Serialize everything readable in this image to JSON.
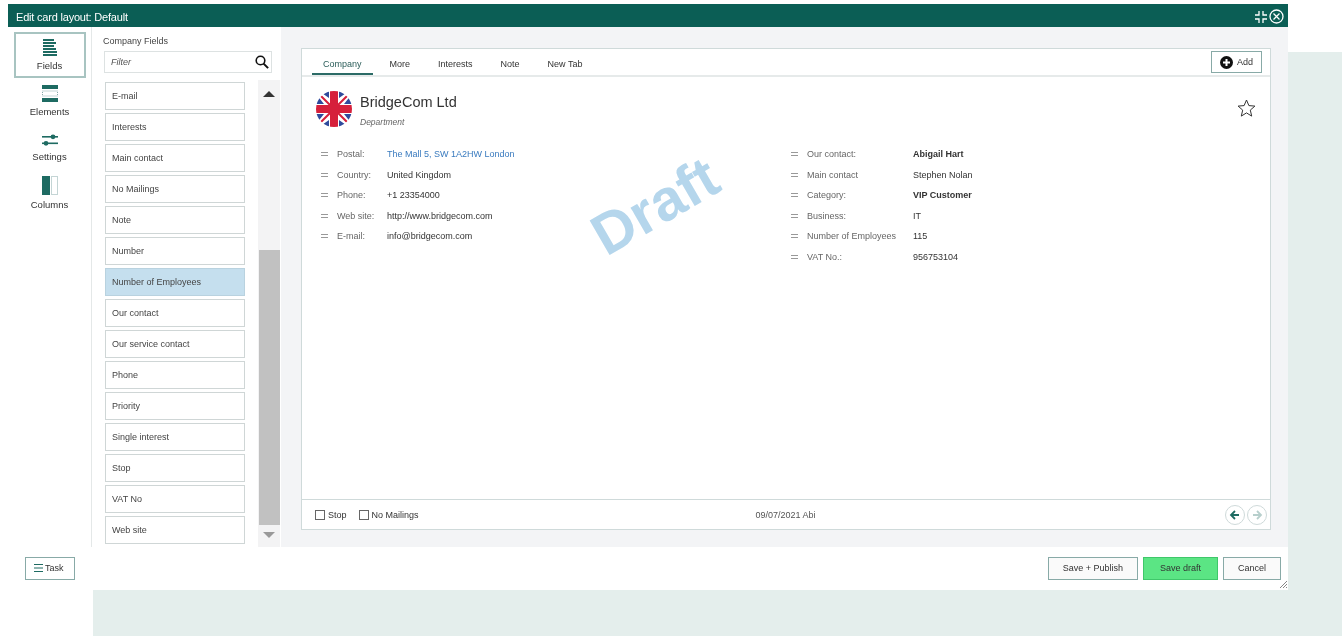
{
  "window": {
    "title": "Edit card layout: Default"
  },
  "nav": [
    {
      "label": "Fields",
      "kind": "fields",
      "selected": true
    },
    {
      "label": "Elements",
      "kind": "elements",
      "selected": false
    },
    {
      "label": "Settings",
      "kind": "settings",
      "selected": false
    },
    {
      "label": "Columns",
      "kind": "columns",
      "selected": false
    }
  ],
  "fields_panel": {
    "heading": "Company Fields",
    "filter": {
      "placeholder": "Filter"
    },
    "items": [
      {
        "label": "E-mail",
        "selected": false
      },
      {
        "label": "Interests",
        "selected": false
      },
      {
        "label": "Main contact",
        "selected": false
      },
      {
        "label": "No Mailings",
        "selected": false
      },
      {
        "label": "Note",
        "selected": false
      },
      {
        "label": "Number",
        "selected": false
      },
      {
        "label": "Number of Employees",
        "selected": true
      },
      {
        "label": "Our contact",
        "selected": false
      },
      {
        "label": "Our service contact",
        "selected": false
      },
      {
        "label": "Phone",
        "selected": false
      },
      {
        "label": "Priority",
        "selected": false
      },
      {
        "label": "Single interest",
        "selected": false
      },
      {
        "label": "Stop",
        "selected": false
      },
      {
        "label": "VAT No",
        "selected": false
      },
      {
        "label": "Web site",
        "selected": false
      }
    ]
  },
  "card": {
    "tabs": [
      {
        "label": "Company",
        "selected": true
      },
      {
        "label": "More",
        "selected": false
      },
      {
        "label": "Interests",
        "selected": false
      },
      {
        "label": "Note",
        "selected": false
      },
      {
        "label": "New Tab",
        "selected": false
      }
    ],
    "add_button": "Add",
    "company": "BridgeCom Ltd",
    "department": "Department",
    "watermark": "Draft",
    "left_fields": [
      {
        "label": "Postal:",
        "value": "The Mall 5, SW 1A2HW London",
        "kind": "link"
      },
      {
        "label": "Country:",
        "value": "United Kingdom",
        "kind": "plain"
      },
      {
        "label": "Phone:",
        "value": "+1 23354000",
        "kind": "plain"
      },
      {
        "label": "Web site:",
        "value": "http://www.bridgecom.com",
        "kind": "plain"
      },
      {
        "label": "E-mail:",
        "value": "info@bridgecom.com",
        "kind": "plain"
      }
    ],
    "right_fields": [
      {
        "label": "Our contact:",
        "value": "Abigail Hart",
        "kind": "bold"
      },
      {
        "label": "Main contact",
        "value": "Stephen Nolan",
        "kind": "plain"
      },
      {
        "label": "Category:",
        "value": "VIP Customer",
        "kind": "bold"
      },
      {
        "label": "Business:",
        "value": "IT",
        "kind": "plain"
      },
      {
        "label": "Number of Employees",
        "value": "115",
        "kind": "plain"
      },
      {
        "label": "VAT No.:",
        "value": "956753104",
        "kind": "plain"
      }
    ],
    "footer": {
      "checkboxes": [
        {
          "label": "Stop",
          "checked": false
        },
        {
          "label": "No Mailings",
          "checked": false
        }
      ],
      "stamp": "09/07/2021 Abi",
      "arrows": [
        {
          "kind": "back",
          "disabled": false
        },
        {
          "kind": "forward",
          "disabled": true
        }
      ]
    }
  },
  "task_button": "Task",
  "buttons": [
    {
      "label": "Save + Publish",
      "kind": "secondary"
    },
    {
      "label": "Save draft",
      "kind": "primary"
    },
    {
      "label": "Cancel",
      "kind": "secondary"
    }
  ]
}
